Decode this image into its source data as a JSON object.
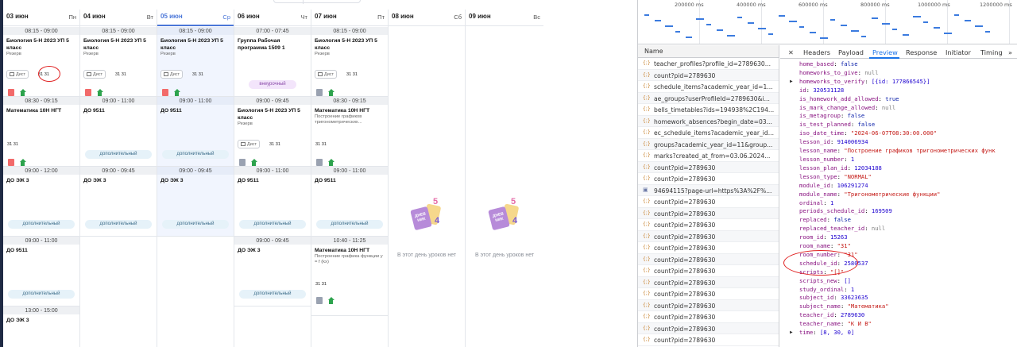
{
  "schedule": {
    "days": [
      {
        "date": "03 июн",
        "dow": "Пн",
        "selected": false
      },
      {
        "date": "04 июн",
        "dow": "Вт",
        "selected": false
      },
      {
        "date": "05 июн",
        "dow": "Ср",
        "selected": true
      },
      {
        "date": "06 июн",
        "dow": "Чт",
        "selected": false
      },
      {
        "date": "07 июн",
        "dow": "Пт",
        "selected": false
      },
      {
        "date": "08 июн",
        "dow": "Сб",
        "selected": false
      },
      {
        "date": "09 июн",
        "dow": "Вс",
        "selected": false
      }
    ],
    "lessons": {
      "mon1": {
        "time": "08:15 - 09:00",
        "subject": "Биология 5-Н 2023 УП 5 класс",
        "note": "Резерв",
        "dist": "Дист",
        "room": "31 31"
      },
      "mon2": {
        "time": "08:30 - 09:15",
        "subject": "Математика 10Н НГТ",
        "room": "31 31"
      },
      "mon3": {
        "time": "09:00 - 12:00",
        "subject": "ДО ЭЖ 3",
        "chip": "дополнительный"
      },
      "mon4": {
        "time": "09:00 - 11:00",
        "subject": "ДО 9511",
        "chip": "дополнительный"
      },
      "mon5": {
        "time": "13:00 - 15:00",
        "subject": "ДО ЭЖ 3"
      },
      "tue1": {
        "time": "08:15 - 09:00",
        "subject": "Биология 5-Н 2023 УП 5 класс",
        "note": "Резерв",
        "dist": "Дист",
        "room": "31 31"
      },
      "tue2": {
        "time": "09:00 - 11:00",
        "subject": "ДО 9511",
        "chip": "дополнительный"
      },
      "tue3": {
        "time": "09:00 - 09:45",
        "subject": "ДО ЭЖ 3",
        "chip": "дополнительный"
      },
      "wed1": {
        "time": "08:15 - 09:00",
        "subject": "Биология 5-Н 2023 УП 5 класс",
        "note": "Резерв",
        "dist": "Дист",
        "room": "31 31"
      },
      "wed2": {
        "time": "09:00 - 11:00",
        "subject": "ДО 9511",
        "chip": "дополнительный"
      },
      "wed3": {
        "time": "09:00 - 09:45",
        "subject": "ДО ЭЖ 3",
        "chip": "дополнительный"
      },
      "thu1": {
        "time": "07:00 - 07:45",
        "subject": "Группа Рабочая программа 1509 1",
        "chip": "внеурочный"
      },
      "thu2": {
        "time": "09:00 - 09:45",
        "subject": "Биология 5-Н 2023 УП 5 класс",
        "note": "Резерв",
        "dist": "Дист",
        "room": "31 31"
      },
      "thu3": {
        "time": "09:00 - 11:00",
        "subject": "ДО 9511",
        "chip": "дополнительный"
      },
      "thu4": {
        "time": "09:00 - 09:45",
        "subject": "ДО ЭЖ 3",
        "chip": "дополнительный"
      },
      "fri1": {
        "time": "08:15 - 09:00",
        "subject": "Биология 5-Н 2023 УП 5 класс",
        "note": "Резерв",
        "dist": "Дист",
        "room": "31 31"
      },
      "fri2": {
        "time": "08:30 - 09:15",
        "subject": "Математика 10Н НГТ",
        "note": "Построение графиков тригонометрических...",
        "room": "31 31"
      },
      "fri3": {
        "time": "09:00 - 11:00",
        "subject": "ДО 9511",
        "chip": "дополнительный"
      },
      "fri4": {
        "time": "10:40 - 11:25",
        "subject": "Математика 10Н НГТ",
        "note": "Построение графика функции y = f (kx)",
        "room": "31 31"
      }
    },
    "empty_day_text": "В этот день уроков нет",
    "empty_card_text": "ДНЕВ НИК",
    "colors": {
      "accent": "#4a76d8",
      "chip_green": "#e6f2f9",
      "chip_purple": "#f3e5fb",
      "annotation": "#e02020"
    }
  },
  "devtools": {
    "timeline_ticks": [
      "200000 ms",
      "400000 ms",
      "600000 ms",
      "800000 ms",
      "1000000 ms",
      "1200000 ms"
    ],
    "name_header": "Name",
    "requests": [
      "teacher_profiles?profile_id=2789630...",
      "count?pid=2789630",
      "schedule_items?academic_year_id=1...",
      "ae_groups?userProfileId=2789630&i...",
      "bells_timetables?ids=194938%2C194...",
      "homework_absences?begin_date=03...",
      "ec_schedule_items?academic_year_id...",
      "groups?academic_year_id=11&group...",
      "marks?created_at_from=03.06.2024...",
      "count?pid=2789630",
      "count?pid=2789630",
      "94694115?page-url=https%3A%2F%...",
      "count?pid=2789630",
      "count?pid=2789630",
      "count?pid=2789630",
      "count?pid=2789630",
      "count?pid=2789630",
      "count?pid=2789630",
      "count?pid=2789630",
      "count?pid=2789630",
      "count?pid=2789630",
      "count?pid=2789630",
      "count?pid=2789630",
      "count?pid=2789630",
      "count?pid=2789630"
    ],
    "tabs": [
      "Headers",
      "Payload",
      "Preview",
      "Response",
      "Initiator",
      "Timing"
    ],
    "active_tab": "Preview",
    "preview": [
      {
        "k": "home_based",
        "v": "false",
        "t": "b"
      },
      {
        "k": "homeworks_to_give",
        "v": "null",
        "t": "null"
      },
      {
        "k": "homeworks_to_verify",
        "v": "[{id: 177866545}]",
        "t": "n",
        "arrow": true
      },
      {
        "k": "id",
        "v": "320531128",
        "t": "n"
      },
      {
        "k": "is_homework_add_allowed",
        "v": "true",
        "t": "b"
      },
      {
        "k": "is_mark_change_allowed",
        "v": "null",
        "t": "null"
      },
      {
        "k": "is_metagroup",
        "v": "false",
        "t": "b"
      },
      {
        "k": "is_test_planned",
        "v": "false",
        "t": "b"
      },
      {
        "k": "iso_date_time",
        "v": "\"2024-06-07T08:30:00.000\"",
        "t": "s"
      },
      {
        "k": "lesson_id",
        "v": "914006934",
        "t": "n"
      },
      {
        "k": "lesson_name",
        "v": "\"Построение графиков тригонометрических функ",
        "t": "s"
      },
      {
        "k": "lesson_number",
        "v": "1",
        "t": "n"
      },
      {
        "k": "lesson_plan_id",
        "v": "12034188",
        "t": "n"
      },
      {
        "k": "lesson_type",
        "v": "\"NORMAL\"",
        "t": "s"
      },
      {
        "k": "module_id",
        "v": "106291274",
        "t": "n"
      },
      {
        "k": "module_name",
        "v": "\"Тригонометрические функции\"",
        "t": "s"
      },
      {
        "k": "ordinal",
        "v": "1",
        "t": "n"
      },
      {
        "k": "periods_schedule_id",
        "v": "169509",
        "t": "n"
      },
      {
        "k": "replaced",
        "v": "false",
        "t": "b"
      },
      {
        "k": "replaced_teacher_id",
        "v": "null",
        "t": "null"
      },
      {
        "k": "room_id",
        "v": "15263",
        "t": "n"
      },
      {
        "k": "room_name",
        "v": "\"31\"",
        "t": "s"
      },
      {
        "k": "room_number",
        "v": "\"31\"",
        "t": "s"
      },
      {
        "k": "schedule_id",
        "v": "2580537",
        "t": "n"
      },
      {
        "k": "scripts",
        "v": "\"[]\"",
        "t": "s"
      },
      {
        "k": "scripts_new",
        "v": "[]",
        "t": "n"
      },
      {
        "k": "study_ordinal",
        "v": "1",
        "t": "n"
      },
      {
        "k": "subject_id",
        "v": "33623635",
        "t": "n"
      },
      {
        "k": "subject_name",
        "v": "\"Математика\"",
        "t": "s"
      },
      {
        "k": "teacher_id",
        "v": "2789630",
        "t": "n"
      },
      {
        "k": "teacher_name",
        "v": "\"К И В\"",
        "t": "s"
      },
      {
        "k": "time",
        "v": "[8, 30, 0]",
        "t": "n",
        "arrow": true
      }
    ]
  }
}
